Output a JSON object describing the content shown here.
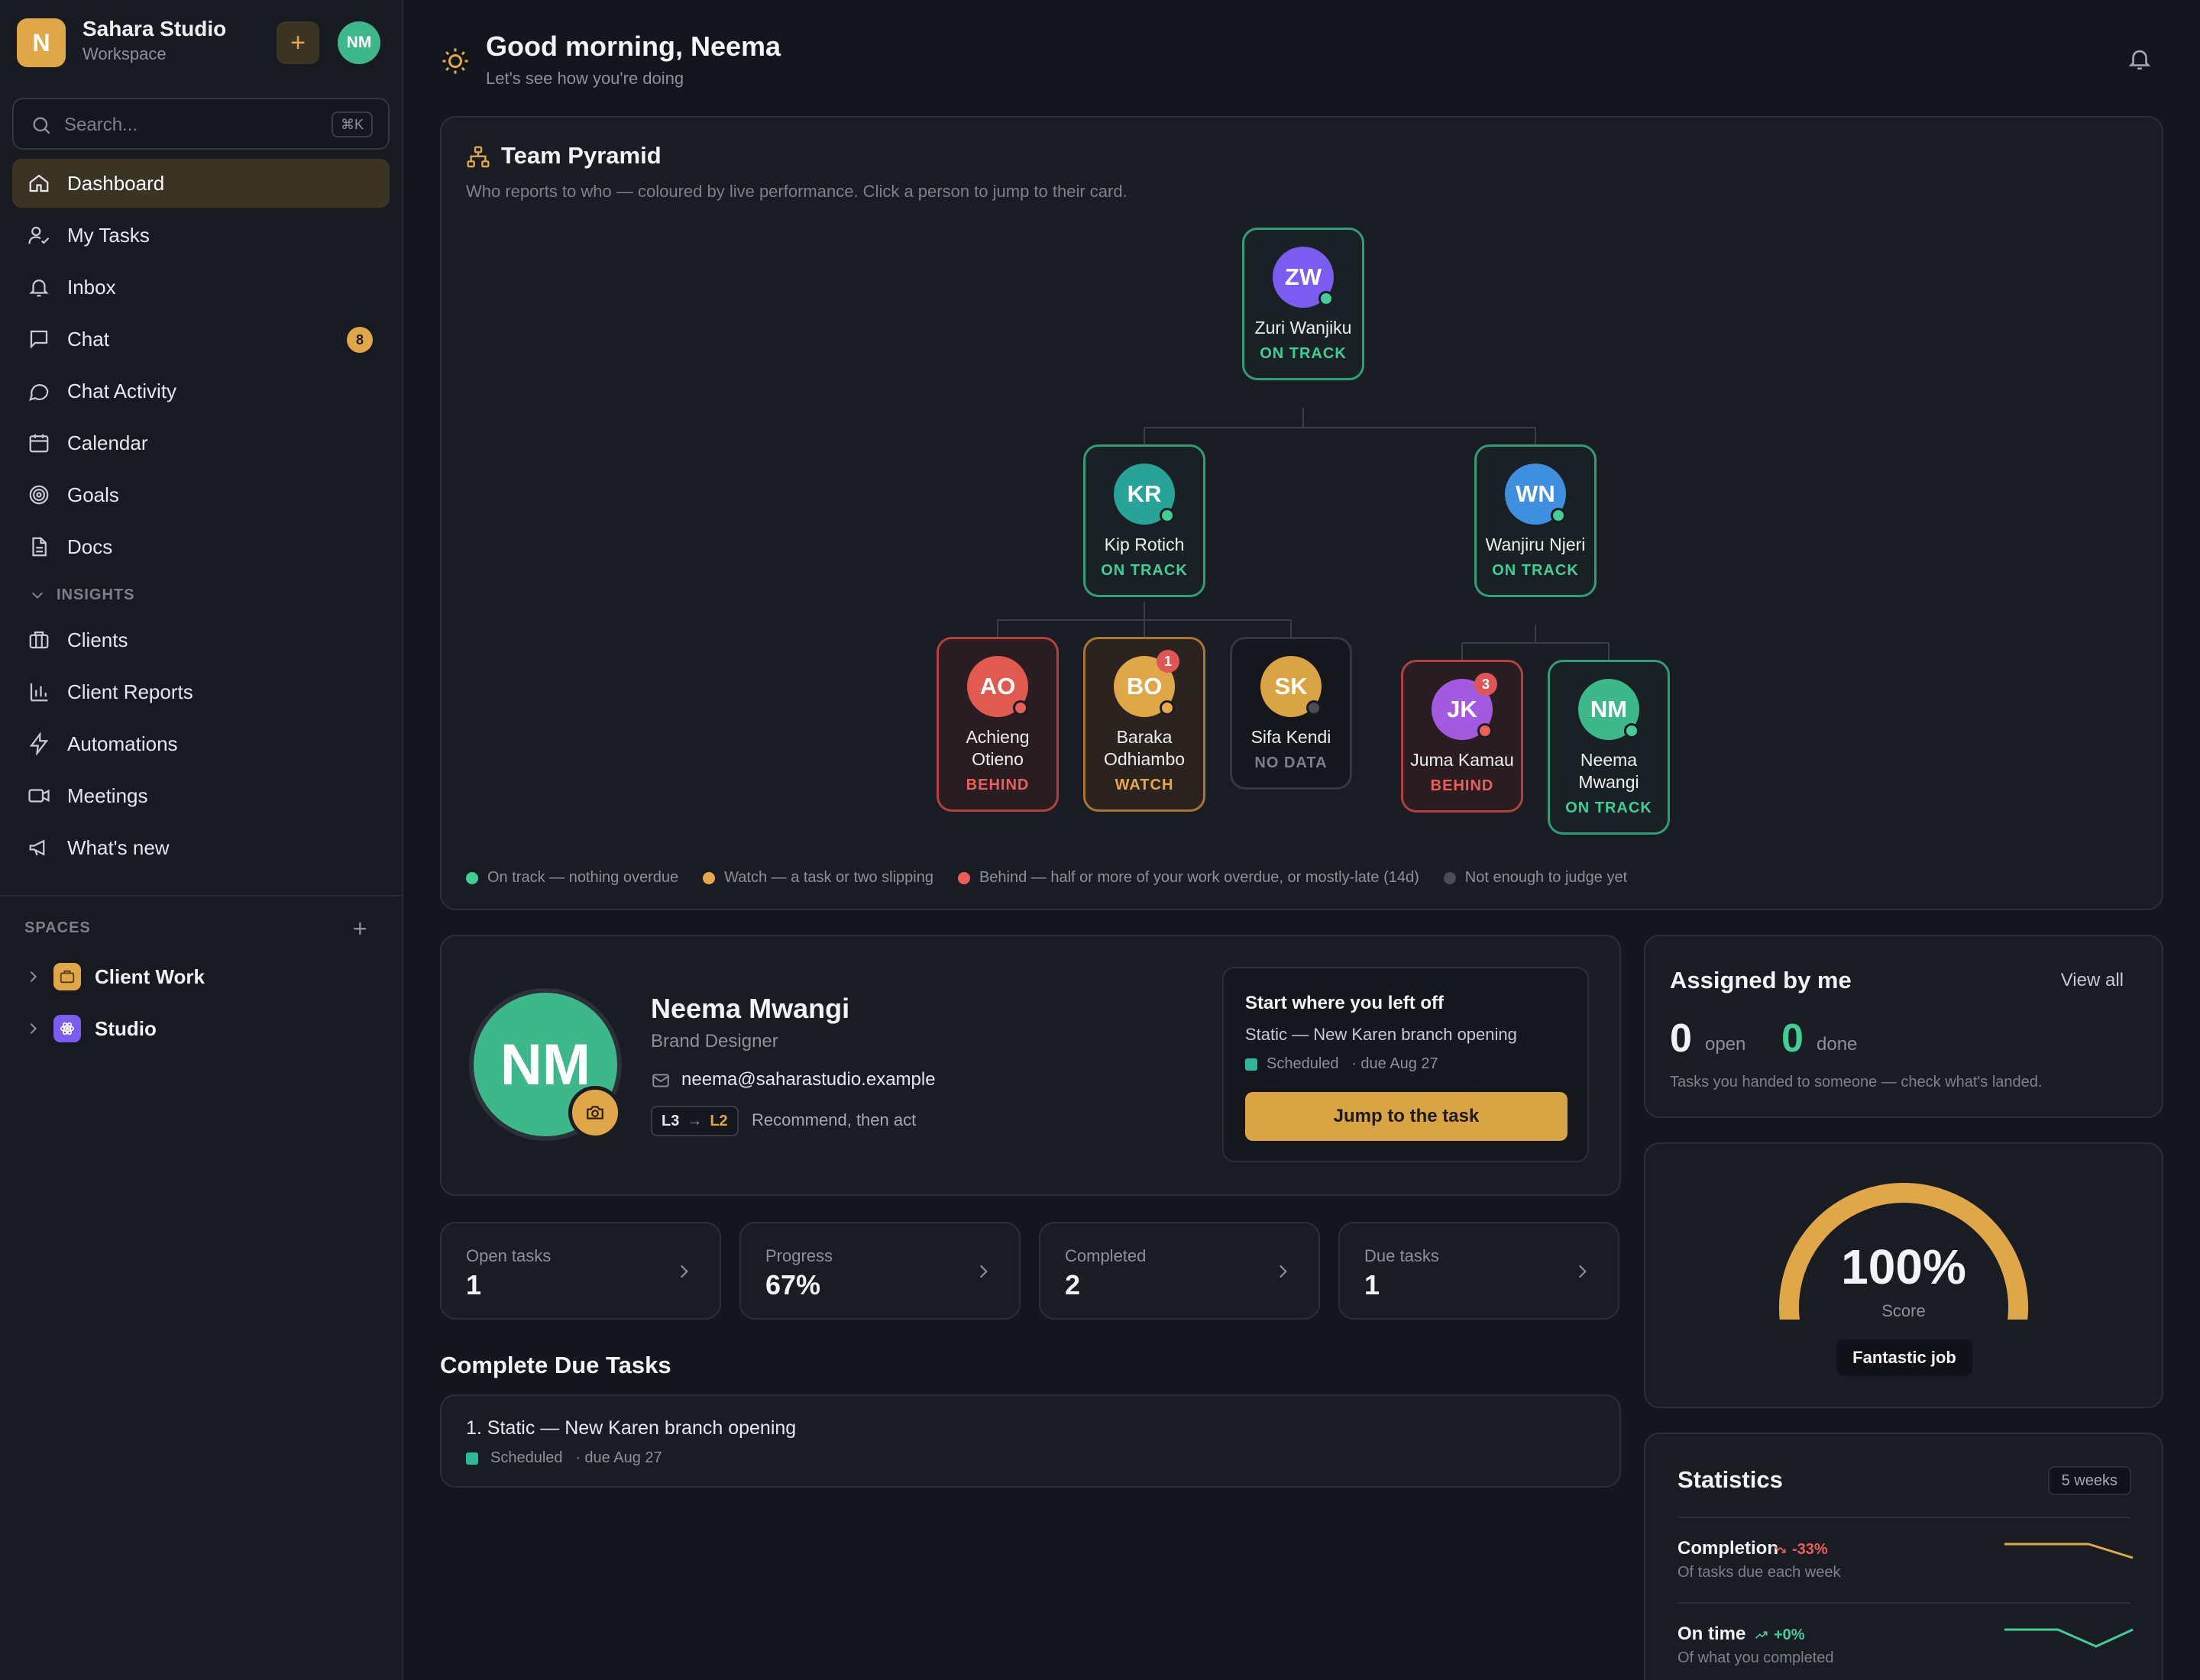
{
  "workspace": {
    "logo_letter": "N",
    "name": "Sahara Studio",
    "subtitle": "Workspace",
    "add_label": "+",
    "user_initials": "NM"
  },
  "search": {
    "placeholder": "Search...",
    "shortcut": "⌘K"
  },
  "nav": {
    "dashboard": "Dashboard",
    "my_tasks": "My Tasks",
    "inbox": "Inbox",
    "chat": "Chat",
    "chat_badge": "8",
    "chat_activity": "Chat Activity",
    "calendar": "Calendar",
    "goals": "Goals",
    "docs": "Docs",
    "insights_header": "INSIGHTS",
    "clients": "Clients",
    "client_reports": "Client Reports",
    "automations": "Automations",
    "meetings": "Meetings",
    "whats_new": "What's new"
  },
  "spaces": {
    "header": "SPACES",
    "add_label": "+",
    "items": [
      "Client Work",
      "Studio"
    ]
  },
  "header": {
    "greeting": "Good morning, Neema",
    "subtitle": "Let's see how you're doing"
  },
  "pyramid": {
    "title": "Team Pyramid",
    "subtitle": "Who reports to who — coloured by live performance. Click a person to jump to their card.",
    "nodes": {
      "zw": {
        "initials": "ZW",
        "name": "Zuri Wanjiku",
        "status": "ON TRACK",
        "color": "#7b5cf0"
      },
      "kr": {
        "initials": "KR",
        "name": "Kip Rotich",
        "status": "ON TRACK",
        "color": "#27a397"
      },
      "wn": {
        "initials": "WN",
        "name": "Wanjiru Njeri",
        "status": "ON TRACK",
        "color": "#3f8fe0"
      },
      "ao": {
        "initials": "AO",
        "name": "Achieng Otieno",
        "status": "BEHIND",
        "color": "#e05a4f"
      },
      "bo": {
        "initials": "BO",
        "name": "Baraka Odhiambo",
        "status": "WATCH",
        "color": "#e0a748",
        "count": "1"
      },
      "sk": {
        "initials": "SK",
        "name": "Sifa Kendi",
        "status": "NO DATA",
        "color": "#d9a443"
      },
      "jk": {
        "initials": "JK",
        "name": "Juma Kamau",
        "status": "BEHIND",
        "color": "#a45ae0",
        "count": "3"
      },
      "nm": {
        "initials": "NM",
        "name": "Neema Mwangi",
        "status": "ON TRACK",
        "color": "#3cb88a"
      }
    },
    "legend": [
      {
        "label": "On track — nothing overdue",
        "color": "#3fcf95"
      },
      {
        "label": "Watch — a task or two slipping",
        "color": "#e6a94c"
      },
      {
        "label": "Behind — half or more of your work overdue, or mostly-late (14d)",
        "color": "#ea5f5a"
      },
      {
        "label": "Not enough to judge yet",
        "color": "#4a4d57"
      }
    ]
  },
  "profile": {
    "initials": "NM",
    "name": "Neema Mwangi",
    "role": "Brand Designer",
    "email": "neema@saharastudio.example",
    "level_from": "L3",
    "level_arrow": "→",
    "level_to": "L2",
    "level_note": "Recommend, then act"
  },
  "resume": {
    "title": "Start where you left off",
    "task": "Static — New Karen branch opening",
    "status": "Scheduled",
    "due": "· due Aug 27",
    "button": "Jump to the task"
  },
  "stats": [
    {
      "label": "Open tasks",
      "value": "1"
    },
    {
      "label": "Progress",
      "value": "67%"
    },
    {
      "label": "Completed",
      "value": "2"
    },
    {
      "label": "Due tasks",
      "value": "1"
    }
  ],
  "due": {
    "title": "Complete Due Tasks",
    "items": [
      {
        "title": "1. Static — New Karen branch opening",
        "status": "Scheduled",
        "due": "· due Aug 27"
      }
    ]
  },
  "assigned": {
    "title": "Assigned by me",
    "view_all": "View all",
    "open_count": "0",
    "open_label": "open",
    "done_count": "0",
    "done_label": "done",
    "hint": "Tasks you handed to someone — check what's landed."
  },
  "score": {
    "percent": "100%",
    "percent_value": 100,
    "label": "Score",
    "tag": "Fantastic job"
  },
  "statistics": {
    "title": "Statistics",
    "range": "5 weeks",
    "rows": [
      {
        "name": "Completion",
        "change": "-33%",
        "sub": "Of tasks due each week",
        "color": "#ea5f5a",
        "line_color": "#e0a748"
      },
      {
        "name": "On time",
        "change": "+0%",
        "sub": "Of what you completed",
        "color": "#3fcf95",
        "line_color": "#3fcf95"
      }
    ]
  },
  "colors": {
    "accent": "#e0a748",
    "on_track": "#3fcf95",
    "behind": "#ea5f5a",
    "watch": "#e6a94c"
  }
}
